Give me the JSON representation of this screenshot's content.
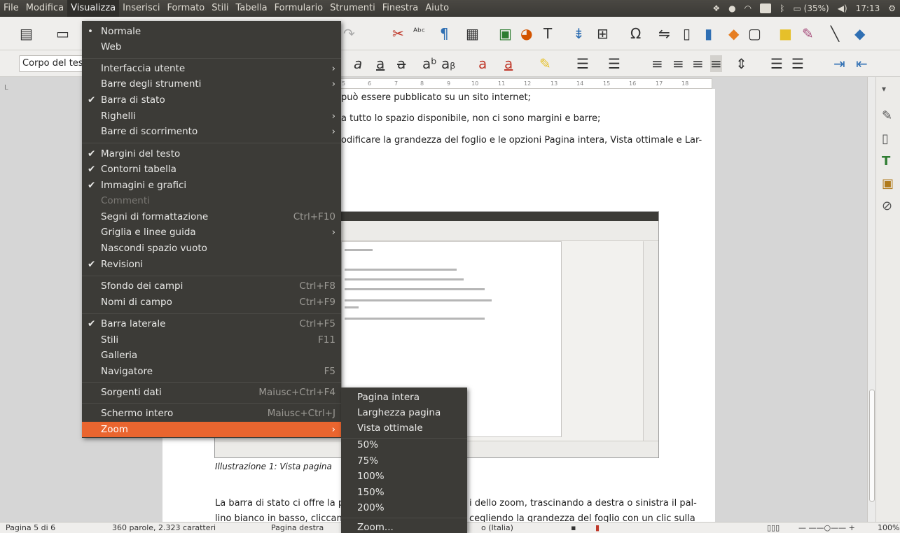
{
  "menubar": {
    "items": [
      "File",
      "Modifica",
      "Visualizza",
      "Inserisci",
      "Formato",
      "Stili",
      "Tabella",
      "Formulario",
      "Strumenti",
      "Finestra",
      "Aiuto"
    ],
    "active_index": 2
  },
  "tray": {
    "keyboard": "It",
    "battery": "(35%)",
    "time": "17:13"
  },
  "toolbar2": {
    "paragraph_style": "Corpo del testo"
  },
  "ruler": {
    "ticks": [
      "5",
      "6",
      "7",
      "8",
      "9",
      "10",
      "11",
      "12",
      "13",
      "14",
      "15",
      "16",
      "17",
      "18"
    ]
  },
  "document": {
    "lines": [
      "può essere pubblicato su un sito internet;",
      "a tutto lo spazio disponibile, non ci sono margini e barre;",
      "odificare la grandezza del foglio e le opzioni Pagina intera, Vista ottimale e Lar-"
    ],
    "caption": "Illustrazione 1: Vista pagina",
    "para_line1_left": "La barra di stato ci offre la poss",
    "para_line1_right": "i dello zoom, trascinando a destra o sinistra il pal-",
    "para_line2_left": "lino bianco in basso, cliccando",
    "para_line2_right": "cegliendo la grandezza del foglio con un clic sulla"
  },
  "statusbar": {
    "page": "Pagina 5 di 6",
    "words": "360 parole, 2.323 caratteri",
    "page_style": "Pagina destra",
    "language": "o (Italia)",
    "zoom": "100%"
  },
  "menu": {
    "rows": [
      {
        "label": "Normale",
        "check": "•",
        "shortcut": "",
        "submenu": false,
        "disabled": false
      },
      {
        "label": "Web",
        "check": "",
        "shortcut": "",
        "submenu": false,
        "disabled": false
      },
      {
        "label": "Interfaccia utente",
        "check": "",
        "shortcut": "",
        "submenu": true,
        "disabled": false
      },
      {
        "label": "Barre degli strumenti",
        "check": "",
        "shortcut": "",
        "submenu": true,
        "disabled": false
      },
      {
        "label": "Barra di stato",
        "check": "✔",
        "shortcut": "",
        "submenu": false,
        "disabled": false
      },
      {
        "label": "Righelli",
        "check": "",
        "shortcut": "",
        "submenu": true,
        "disabled": false
      },
      {
        "label": "Barre di scorrimento",
        "check": "",
        "shortcut": "",
        "submenu": true,
        "disabled": false
      },
      {
        "label": "Margini del testo",
        "check": "✔",
        "shortcut": "",
        "submenu": false,
        "disabled": false
      },
      {
        "label": "Contorni tabella",
        "check": "✔",
        "shortcut": "",
        "submenu": false,
        "disabled": false
      },
      {
        "label": "Immagini e grafici",
        "check": "✔",
        "shortcut": "",
        "submenu": false,
        "disabled": false
      },
      {
        "label": "Commenti",
        "check": "",
        "shortcut": "",
        "submenu": false,
        "disabled": true
      },
      {
        "label": "Segni di formattazione",
        "check": "",
        "shortcut": "Ctrl+F10",
        "submenu": false,
        "disabled": false
      },
      {
        "label": "Griglia e linee guida",
        "check": "",
        "shortcut": "",
        "submenu": true,
        "disabled": false
      },
      {
        "label": "Nascondi spazio vuoto",
        "check": "",
        "shortcut": "",
        "submenu": false,
        "disabled": false
      },
      {
        "label": "Revisioni",
        "check": "✔",
        "shortcut": "",
        "submenu": false,
        "disabled": false
      },
      {
        "label": "Sfondo dei campi",
        "check": "",
        "shortcut": "Ctrl+F8",
        "submenu": false,
        "disabled": false
      },
      {
        "label": "Nomi di campo",
        "check": "",
        "shortcut": "Ctrl+F9",
        "submenu": false,
        "disabled": false
      },
      {
        "label": "Barra laterale",
        "check": "✔",
        "shortcut": "Ctrl+F5",
        "submenu": false,
        "disabled": false
      },
      {
        "label": "Stili",
        "check": "",
        "shortcut": "F11",
        "submenu": false,
        "disabled": false
      },
      {
        "label": "Galleria",
        "check": "",
        "shortcut": "",
        "submenu": false,
        "disabled": false
      },
      {
        "label": "Navigatore",
        "check": "",
        "shortcut": "F5",
        "submenu": false,
        "disabled": false
      },
      {
        "label": "Sorgenti dati",
        "check": "",
        "shortcut": "Maiusc+Ctrl+F4",
        "submenu": false,
        "disabled": false
      },
      {
        "label": "Schermo intero",
        "check": "",
        "shortcut": "Maiusc+Ctrl+J",
        "submenu": false,
        "disabled": false
      },
      {
        "label": "Zoom",
        "check": "",
        "shortcut": "",
        "submenu": true,
        "disabled": false,
        "active": true
      }
    ]
  },
  "submenu": {
    "rows": [
      "Pagina intera",
      "Larghezza pagina",
      "Vista ottimale",
      "50%",
      "75%",
      "100%",
      "150%",
      "200%",
      "Zoom..."
    ]
  },
  "icons": {
    "submenu_arrow": "›",
    "menu_check": "✔"
  }
}
